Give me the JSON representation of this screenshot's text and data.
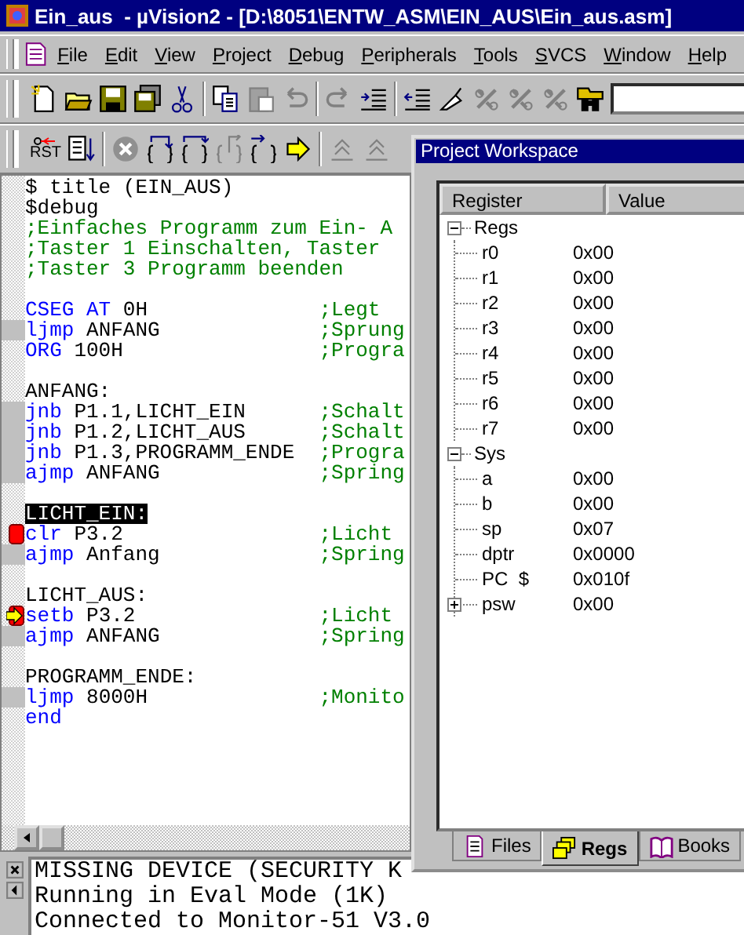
{
  "window": {
    "title": "Ein_aus  - µVision2 - [D:\\8051\\ENTW_ASM\\EIN_AUS\\Ein_aus.asm]"
  },
  "menu": [
    "File",
    "Edit",
    "View",
    "Project",
    "Debug",
    "Peripherals",
    "Tools",
    "SVCS",
    "Window",
    "Help"
  ],
  "toolbar_file": [
    {
      "disabled": false
    },
    {
      "disabled": false
    },
    {
      "disabled": false
    },
    {
      "disabled": false
    },
    {
      "disabled": false
    },
    {
      "disabled": false
    },
    {
      "disabled": true
    },
    {
      "disabled": true
    },
    {
      "disabled": true
    },
    {
      "disabled": false
    },
    {
      "disabled": false
    },
    {
      "disabled": false
    },
    {
      "disabled": true
    },
    {
      "disabled": true
    },
    {
      "disabled": true
    },
    {
      "disabled": false
    }
  ],
  "toolbar_debug": [
    {
      "label": "RST",
      "disabled": false
    },
    {
      "disabled": false
    },
    {
      "disabled": true
    },
    {
      "disabled": false
    },
    {
      "disabled": false
    },
    {
      "disabled": true
    },
    {
      "disabled": false
    },
    {
      "disabled": false
    },
    {
      "disabled": true
    },
    {
      "disabled": true
    }
  ],
  "editor": {
    "lines": [
      {
        "kind": "plain",
        "text": "$ title (EIN_AUS)"
      },
      {
        "kind": "plain",
        "text": "$debug"
      },
      {
        "kind": "comment",
        "text": ";Einfaches Programm zum Ein- A"
      },
      {
        "kind": "comment",
        "text": ";Taster 1 Einschalten, Taster"
      },
      {
        "kind": "comment",
        "text": ";Taster 3 Programm beenden"
      },
      {
        "kind": "blank"
      },
      {
        "kind": "code",
        "keyword": "CSEG AT",
        "operand": "0H",
        "comment": ";Legt",
        "executable": false,
        "breakpoint": false,
        "current": false
      },
      {
        "kind": "code",
        "keyword": "ljmp",
        "operand": "ANFANG",
        "comment": ";Sprung",
        "executable": true,
        "breakpoint": false,
        "current": false
      },
      {
        "kind": "code",
        "keyword": "ORG",
        "operand": "100H",
        "comment": ";Progra",
        "executable": false,
        "breakpoint": false,
        "current": false
      },
      {
        "kind": "blank"
      },
      {
        "kind": "label",
        "text": "ANFANG:",
        "selected": false
      },
      {
        "kind": "code",
        "keyword": "jnb",
        "operand": "P1.1,LICHT_EIN",
        "comment": ";Schalt",
        "executable": true,
        "breakpoint": false,
        "current": false
      },
      {
        "kind": "code",
        "keyword": "jnb",
        "operand": "P1.2,LICHT_AUS",
        "comment": ";Schalt",
        "executable": true,
        "breakpoint": false,
        "current": false
      },
      {
        "kind": "code",
        "keyword": "jnb",
        "operand": "P1.3,PROGRAMM_ENDE",
        "comment": ";Progra",
        "executable": true,
        "breakpoint": false,
        "current": false
      },
      {
        "kind": "code",
        "keyword": "ajmp",
        "operand": "ANFANG",
        "comment": ";Spring",
        "executable": true,
        "breakpoint": false,
        "current": false
      },
      {
        "kind": "blank"
      },
      {
        "kind": "label",
        "text": "LICHT_EIN:",
        "selected": true
      },
      {
        "kind": "code",
        "keyword": "clr",
        "operand": "P3.2",
        "comment": ";Licht",
        "executable": true,
        "breakpoint": true,
        "current": false
      },
      {
        "kind": "code",
        "keyword": "ajmp",
        "operand": "Anfang",
        "comment": ";Spring",
        "executable": true,
        "breakpoint": false,
        "current": false
      },
      {
        "kind": "blank"
      },
      {
        "kind": "label",
        "text": "LICHT_AUS:",
        "selected": false
      },
      {
        "kind": "code",
        "keyword": "setb",
        "operand": "P3.2",
        "comment": ";Licht",
        "executable": true,
        "breakpoint": true,
        "current": true
      },
      {
        "kind": "code",
        "keyword": "ajmp",
        "operand": "ANFANG",
        "comment": ";Spring",
        "executable": true,
        "breakpoint": false,
        "current": false
      },
      {
        "kind": "blank"
      },
      {
        "kind": "label",
        "text": "PROGRAMM_ENDE:",
        "selected": false
      },
      {
        "kind": "code",
        "keyword": "ljmp",
        "operand": "8000H",
        "comment": ";Monito",
        "executable": true,
        "breakpoint": false,
        "current": false
      },
      {
        "kind": "code",
        "keyword": "end",
        "executable": false,
        "breakpoint": false,
        "current": false
      }
    ]
  },
  "output": {
    "lines": [
      "MISSING DEVICE (SECURITY K",
      "Running in Eval Mode (1K)",
      "Connected to Monitor-51 V3.0"
    ]
  },
  "workspace": {
    "title": "Project Workspace",
    "columns": [
      "Register",
      "Value"
    ],
    "registers": [
      {
        "name": "Regs",
        "expanded": true,
        "children": [
          {
            "name": "r0",
            "value": "0x00"
          },
          {
            "name": "r1",
            "value": "0x00"
          },
          {
            "name": "r2",
            "value": "0x00"
          },
          {
            "name": "r3",
            "value": "0x00"
          },
          {
            "name": "r4",
            "value": "0x00"
          },
          {
            "name": "r5",
            "value": "0x00"
          },
          {
            "name": "r6",
            "value": "0x00"
          },
          {
            "name": "r7",
            "value": "0x00"
          }
        ]
      },
      {
        "name": "Sys",
        "expanded": true,
        "children": [
          {
            "name": "a",
            "value": "0x00"
          },
          {
            "name": "b",
            "value": "0x00"
          },
          {
            "name": "sp",
            "value": "0x07"
          },
          {
            "name": "dptr",
            "value": "0x0000"
          },
          {
            "name": "PC  $",
            "value": "0x010f"
          },
          {
            "name": "psw",
            "value": "0x00",
            "expanded": false
          }
        ]
      }
    ],
    "tabs": [
      {
        "label": "Files",
        "selected": false
      },
      {
        "label": "Regs",
        "selected": true
      },
      {
        "label": "Books",
        "selected": false
      }
    ]
  }
}
